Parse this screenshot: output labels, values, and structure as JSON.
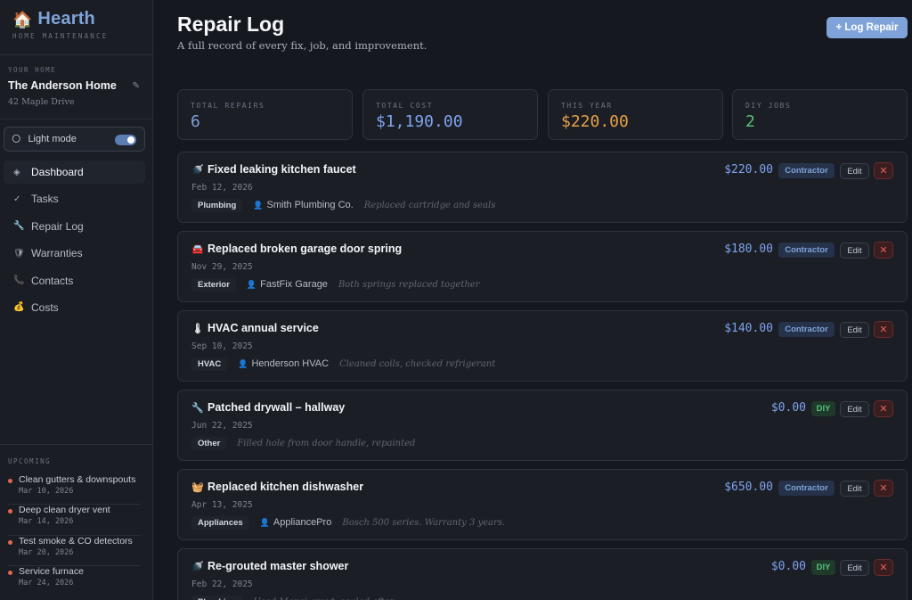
{
  "brand": {
    "icon": "🏠",
    "name": "Hearth",
    "subtitle": "HOME MAINTENANCE"
  },
  "home": {
    "label": "YOUR HOME",
    "name": "The Anderson Home",
    "edit_icon": "✎",
    "address": "42 Maple Drive"
  },
  "mode": {
    "icon": "🌕",
    "label": "Light mode",
    "enabled": true
  },
  "nav": [
    {
      "icon": "◈",
      "label": "Dashboard",
      "active": true
    },
    {
      "icon": "✓",
      "label": "Tasks"
    },
    {
      "icon": "🔧",
      "label": "Repair Log"
    },
    {
      "icon": "🛡",
      "label": "Warranties"
    },
    {
      "icon": "📞",
      "label": "Contacts"
    },
    {
      "icon": "💰",
      "label": "Costs"
    }
  ],
  "upcoming": {
    "label": "UPCOMING",
    "items": [
      {
        "title": "Clean gutters & downspouts",
        "date": "Mar 10, 2026"
      },
      {
        "title": "Deep clean dryer vent",
        "date": "Mar 14, 2026"
      },
      {
        "title": "Test smoke & CO detectors",
        "date": "Mar 20, 2026"
      },
      {
        "title": "Service furnace",
        "date": "Mar 24, 2026"
      }
    ]
  },
  "page": {
    "title": "Repair Log",
    "subtitle": "A full record of every fix, job, and improvement.",
    "log_button": "+ Log Repair"
  },
  "stats": [
    {
      "label": "TOTAL REPAIRS",
      "value": "6",
      "color": "#7fa3d8"
    },
    {
      "label": "TOTAL COST",
      "value": "$1,190.00",
      "color": "#7fa3ee"
    },
    {
      "label": "THIS YEAR",
      "value": "$220.00",
      "color": "#e8a04a"
    },
    {
      "label": "DIY JOBS",
      "value": "2",
      "color": "#59c27b"
    }
  ],
  "repairs": [
    {
      "icon": "🚿",
      "title": "Fixed leaking kitchen faucet",
      "date": "Feb 12, 2026",
      "category": "Plumbing",
      "contractor": "Smith Plumbing Co.",
      "note": "Replaced cartridge and seals",
      "amount": "$220.00",
      "badge": "Contractor"
    },
    {
      "icon": "🚘",
      "title": "Replaced broken garage door spring",
      "date": "Nov 29, 2025",
      "category": "Exterior",
      "contractor": "FastFix Garage",
      "note": "Both springs replaced together",
      "amount": "$180.00",
      "badge": "Contractor"
    },
    {
      "icon": "🌡",
      "title": "HVAC annual service",
      "date": "Sep 10, 2025",
      "category": "HVAC",
      "contractor": "Henderson HVAC",
      "note": "Cleaned coils, checked refrigerant",
      "amount": "$140.00",
      "badge": "Contractor"
    },
    {
      "icon": "🔧",
      "title": "Patched drywall – hallway",
      "date": "Jun 22, 2025",
      "category": "Other",
      "contractor": "",
      "note": "Filled hole from door handle, repainted",
      "amount": "$0.00",
      "badge": "DIY"
    },
    {
      "icon": "🧺",
      "title": "Replaced kitchen dishwasher",
      "date": "Apr 13, 2025",
      "category": "Appliances",
      "contractor": "AppliancePro",
      "note": "Bosch 500 series. Warranty 3 years.",
      "amount": "$650.00",
      "badge": "Contractor"
    },
    {
      "icon": "🚿",
      "title": "Re-grouted master shower",
      "date": "Feb 22, 2025",
      "category": "Plumbing",
      "contractor": "",
      "note": "Used Mapei grout, sealed after",
      "amount": "$0.00",
      "badge": "DIY"
    }
  ],
  "actions": {
    "edit": "Edit",
    "delete_icon": "✕"
  }
}
